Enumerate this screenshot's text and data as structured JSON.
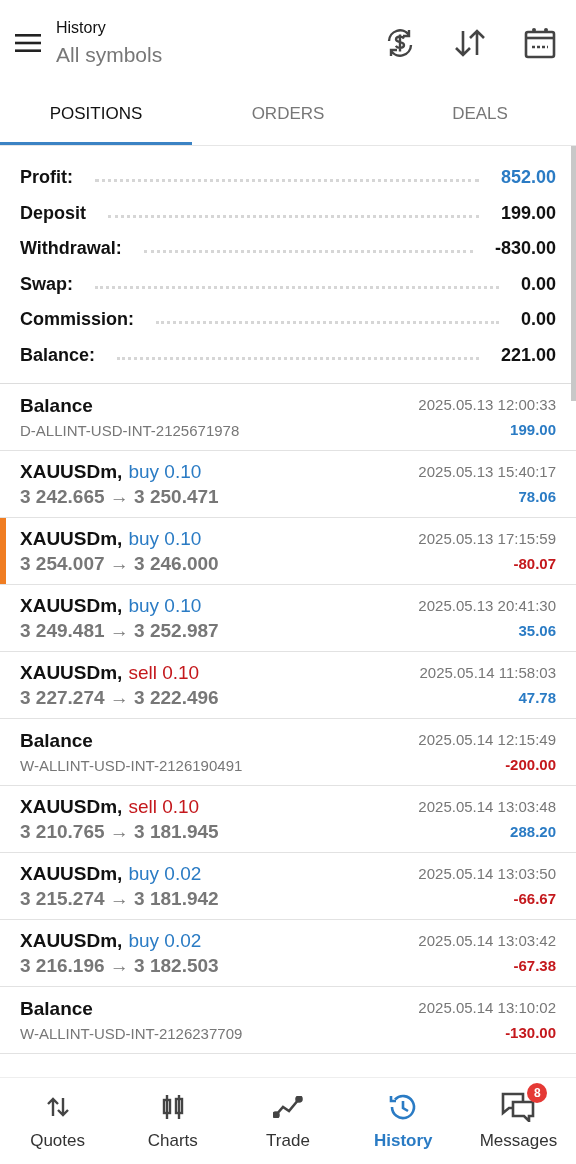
{
  "header": {
    "title": "History",
    "subtitle": "All symbols"
  },
  "tabs": [
    {
      "label": "POSITIONS",
      "selected": true
    },
    {
      "label": "ORDERS",
      "selected": false
    },
    {
      "label": "DEALS",
      "selected": false
    }
  ],
  "summary": [
    {
      "label": "Profit:",
      "value": "852.00",
      "accent": true
    },
    {
      "label": "Deposit",
      "value": "199.00",
      "accent": false
    },
    {
      "label": "Withdrawal:",
      "value": "-830.00",
      "accent": false
    },
    {
      "label": "Swap:",
      "value": "0.00",
      "accent": false
    },
    {
      "label": "Commission:",
      "value": "0.00",
      "accent": false
    },
    {
      "label": "Balance:",
      "value": "221.00",
      "accent": false
    }
  ],
  "rows": [
    {
      "kind": "balance",
      "title": "Balance",
      "detail": "D-ALLINT-USD-INT-2125671978",
      "time": "2025.05.13 12:00:33",
      "amount": "199.00",
      "loss": false,
      "highlighted": false
    },
    {
      "kind": "trade",
      "title": "XAUUSDm,",
      "side": "buy 0.10",
      "sell": false,
      "detail": "3 242.665 → 3 250.471",
      "time": "2025.05.13 15:40:17",
      "amount": "78.06",
      "loss": false,
      "highlighted": false
    },
    {
      "kind": "trade",
      "title": "XAUUSDm,",
      "side": "buy 0.10",
      "sell": false,
      "detail": "3 254.007 → 3 246.000",
      "time": "2025.05.13 17:15:59",
      "amount": "-80.07",
      "loss": true,
      "highlighted": true
    },
    {
      "kind": "trade",
      "title": "XAUUSDm,",
      "side": "buy 0.10",
      "sell": false,
      "detail": "3 249.481 → 3 252.987",
      "time": "2025.05.13 20:41:30",
      "amount": "35.06",
      "loss": false,
      "highlighted": false
    },
    {
      "kind": "trade",
      "title": "XAUUSDm,",
      "side": "sell 0.10",
      "sell": true,
      "detail": "3 227.274 → 3 222.496",
      "time": "2025.05.14 11:58:03",
      "amount": "47.78",
      "loss": false,
      "highlighted": false
    },
    {
      "kind": "balance",
      "title": "Balance",
      "detail": "W-ALLINT-USD-INT-2126190491",
      "time": "2025.05.14 12:15:49",
      "amount": "-200.00",
      "loss": true,
      "highlighted": false
    },
    {
      "kind": "trade",
      "title": "XAUUSDm,",
      "side": "sell 0.10",
      "sell": true,
      "detail": "3 210.765 → 3 181.945",
      "time": "2025.05.14 13:03:48",
      "amount": "288.20",
      "loss": false,
      "highlighted": false
    },
    {
      "kind": "trade",
      "title": "XAUUSDm,",
      "side": "buy 0.02",
      "sell": false,
      "detail": "3 215.274 → 3 181.942",
      "time": "2025.05.14 13:03:50",
      "amount": "-66.67",
      "loss": true,
      "highlighted": false
    },
    {
      "kind": "trade",
      "title": "XAUUSDm,",
      "side": "buy 0.02",
      "sell": false,
      "detail": "3 216.196 → 3 182.503",
      "time": "2025.05.14 13:03:42",
      "amount": "-67.38",
      "loss": true,
      "highlighted": false
    },
    {
      "kind": "balance",
      "title": "Balance",
      "detail": "W-ALLINT-USD-INT-2126237709",
      "time": "2025.05.14 13:10:02",
      "amount": "-130.00",
      "loss": true,
      "highlighted": false
    }
  ],
  "nav": [
    {
      "label": "Quotes",
      "selected": false
    },
    {
      "label": "Charts",
      "selected": false
    },
    {
      "label": "Trade",
      "selected": false
    },
    {
      "label": "History",
      "selected": true
    },
    {
      "label": "Messages",
      "selected": false,
      "badge": "8"
    }
  ]
}
